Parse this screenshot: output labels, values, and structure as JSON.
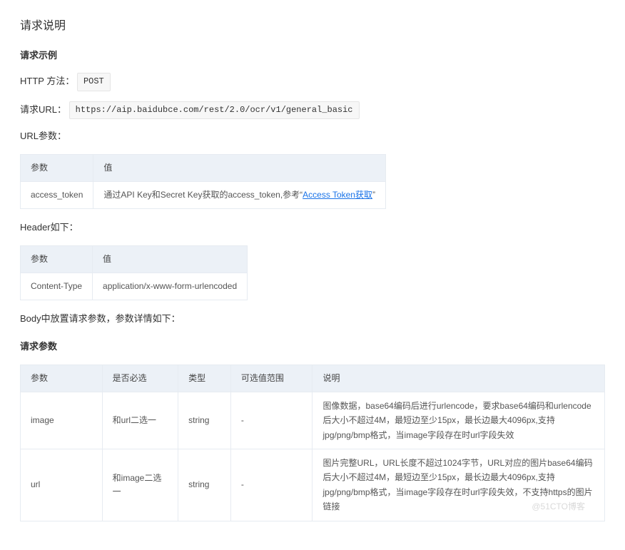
{
  "heading": "请求说明",
  "example_heading": "请求示例",
  "http_method_label": "HTTP 方法：",
  "http_method_value": "POST",
  "request_url_label": "请求URL：",
  "request_url_value": "https://aip.baidubce.com/rest/2.0/ocr/v1/general_basic",
  "url_params_label": "URL参数：",
  "url_params_table": {
    "headers": [
      "参数",
      "值"
    ],
    "row": {
      "param": "access_token",
      "value_pre": "通过API Key和Secret Key获取的access_token,参考“",
      "value_link": "Access Token获取",
      "value_post": "”"
    }
  },
  "header_label": "Header如下：",
  "header_table": {
    "headers": [
      "参数",
      "值"
    ],
    "row": {
      "param": "Content-Type",
      "value": "application/x-www-form-urlencoded"
    }
  },
  "body_label": "Body中放置请求参数，参数详情如下：",
  "params_heading": "请求参数",
  "params_table": {
    "headers": [
      "参数",
      "是否必选",
      "类型",
      "可选值范围",
      "说明"
    ],
    "rows": [
      {
        "param": "image",
        "required": "和url二选一",
        "type": "string",
        "range": "-",
        "desc": "图像数据，base64编码后进行urlencode，要求base64编码和urlencode后大小不超过4M，最短边至少15px，最长边最大4096px,支持jpg/png/bmp格式，当image字段存在时url字段失效"
      },
      {
        "param": "url",
        "required": "和image二选一",
        "type": "string",
        "range": "-",
        "desc": "图片完整URL，URL长度不超过1024字节，URL对应的图片base64编码后大小不超过4M，最短边至少15px，最长边最大4096px,支持jpg/png/bmp格式，当image字段存在时url字段失效，不支持https的图片链接"
      }
    ]
  },
  "watermark": "@51CTO博客"
}
